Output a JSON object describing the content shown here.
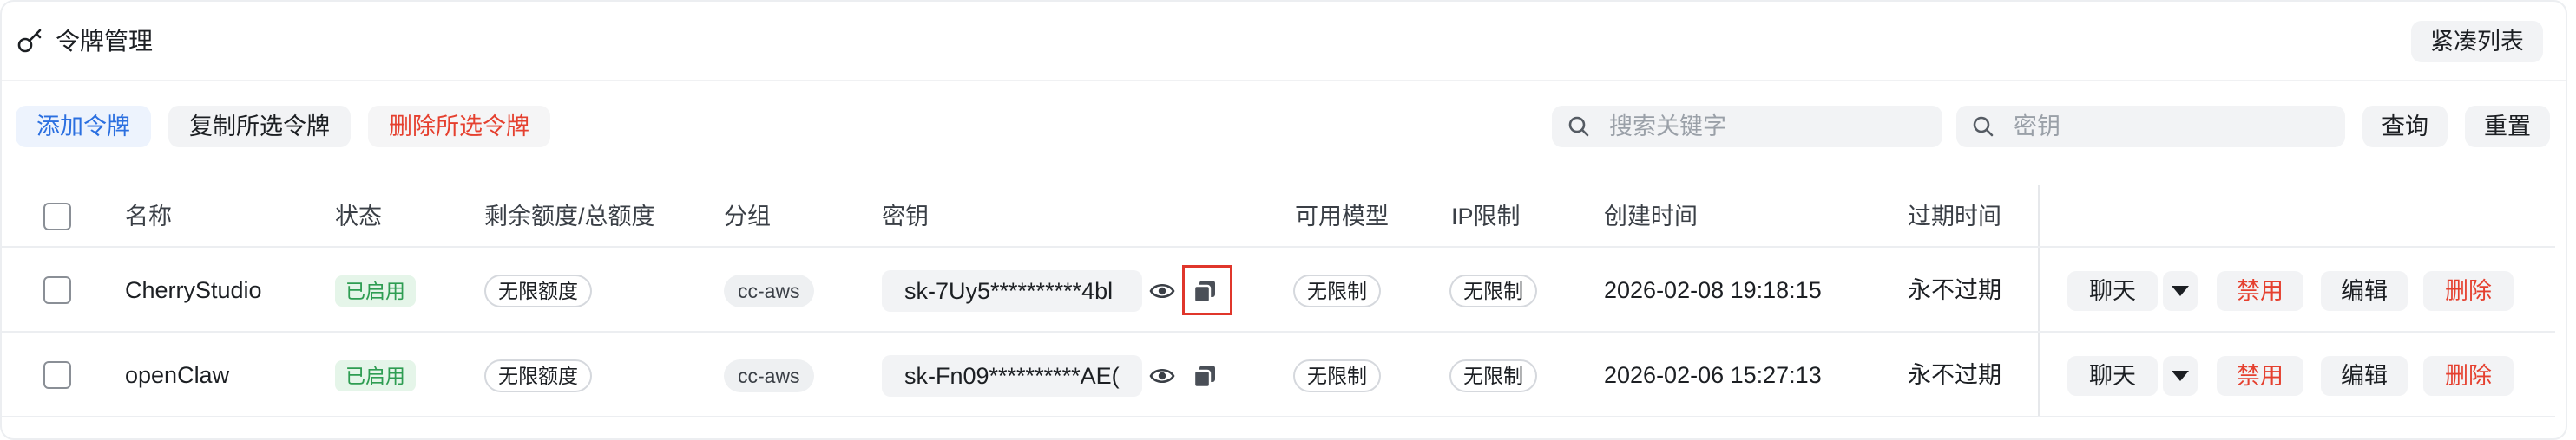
{
  "header": {
    "title": "令牌管理",
    "icon": "key-icon",
    "compact_label": "紧凑列表"
  },
  "toolbar": {
    "add_label": "添加令牌",
    "copy_selected_label": "复制所选令牌",
    "delete_selected_label": "删除所选令牌",
    "search_keyword_placeholder": "搜索关键字",
    "search_key_placeholder": "密钥",
    "query_label": "查询",
    "reset_label": "重置"
  },
  "colors": {
    "accent": "#2b6fe0",
    "danger": "#e5402f",
    "success": "#2e9d52",
    "highlight": "#e0362b"
  },
  "table": {
    "columns": [
      "名称",
      "状态",
      "剩余额度/总额度",
      "分组",
      "密钥",
      "可用模型",
      "IP限制",
      "创建时间",
      "过期时间"
    ],
    "rows": [
      {
        "name": "CherryStudio",
        "status": "已启用",
        "quota": "无限额度",
        "group": "cc-aws",
        "key": "sk-7Uy5**********4bl",
        "models": "无限制",
        "ip": "无限制",
        "created": "2026-02-08 19:18:15",
        "expires": "永不过期",
        "actions": {
          "chat": "聊天",
          "disable": "禁用",
          "edit": "编辑",
          "delete": "删除"
        }
      },
      {
        "name": "openClaw",
        "status": "已启用",
        "quota": "无限额度",
        "group": "cc-aws",
        "key": "sk-Fn09**********AE(",
        "models": "无限制",
        "ip": "无限制",
        "created": "2026-02-06 15:27:13",
        "expires": "永不过期",
        "actions": {
          "chat": "聊天",
          "disable": "禁用",
          "edit": "编辑",
          "delete": "删除"
        }
      }
    ]
  }
}
